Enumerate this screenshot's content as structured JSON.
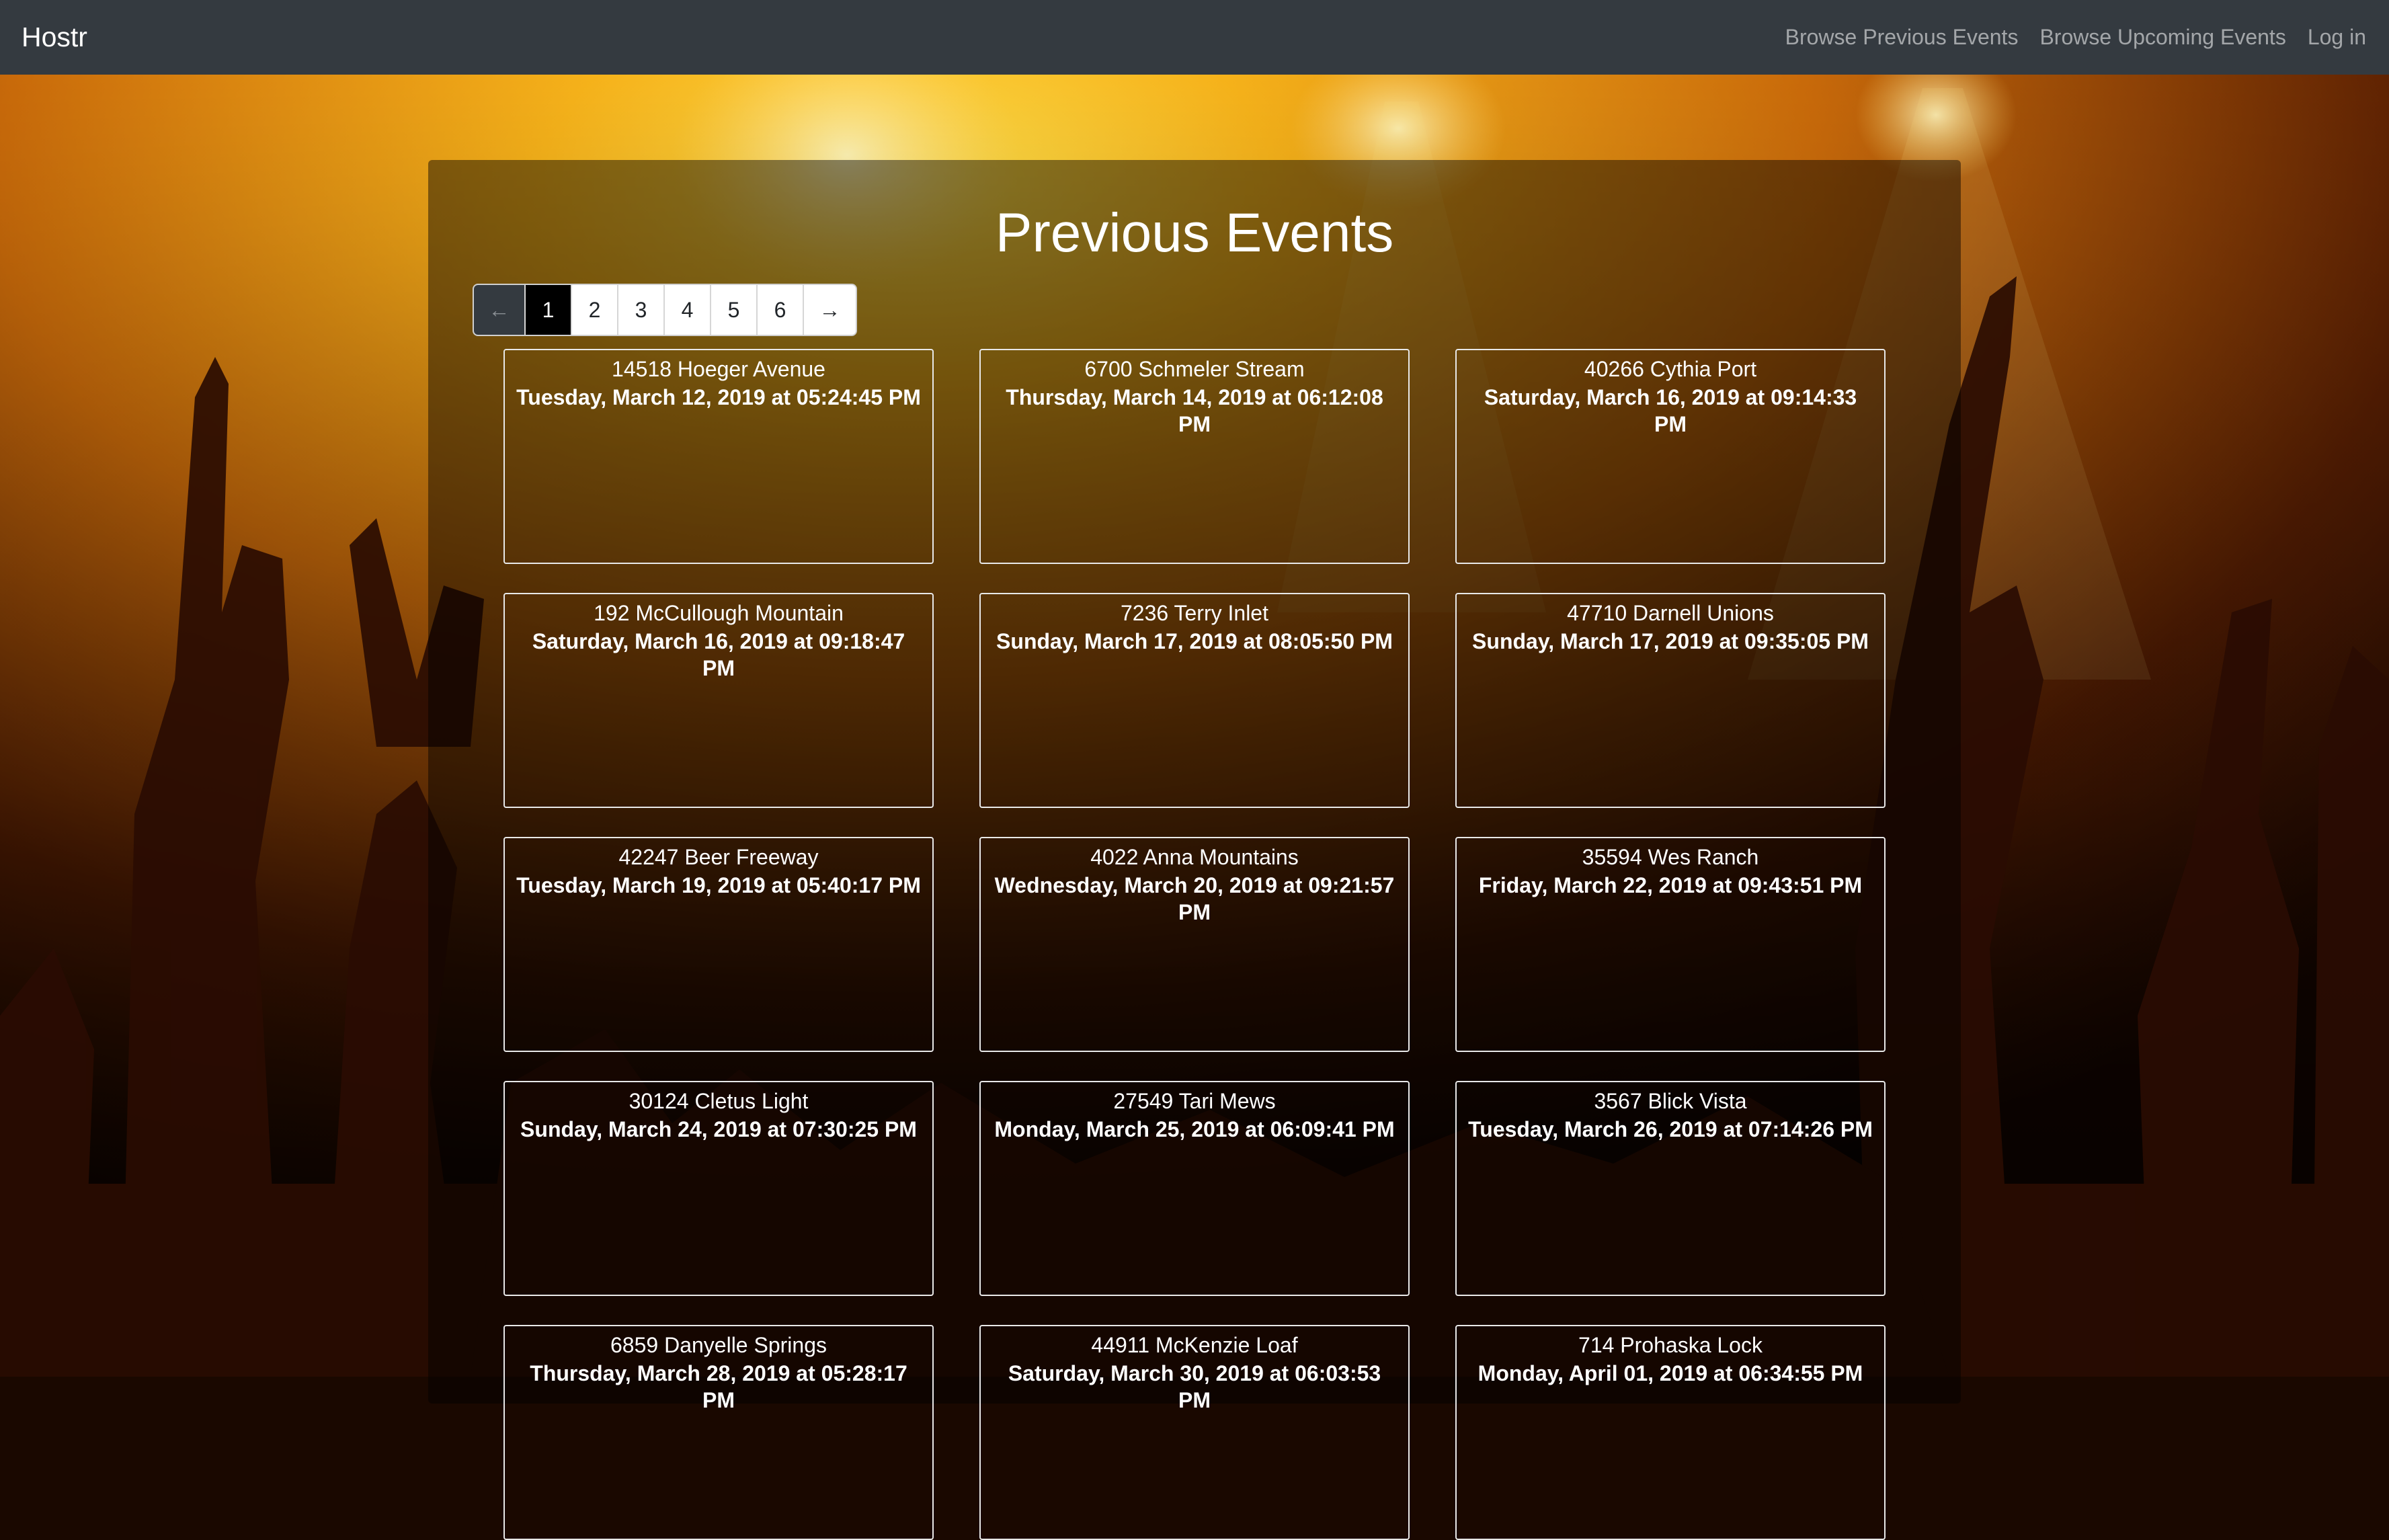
{
  "navbar": {
    "brand": "Hostr",
    "links": [
      "Browse Previous Events",
      "Browse Upcoming Events",
      "Log in"
    ]
  },
  "page": {
    "title": "Previous Events"
  },
  "pagination": {
    "prev": "←",
    "next": "→",
    "pages": [
      "1",
      "2",
      "3",
      "4",
      "5",
      "6"
    ],
    "active_page": "1"
  },
  "events": [
    {
      "address": "14518 Hoeger Avenue",
      "date": "Tuesday, March 12, 2019 at 05:24:45 PM"
    },
    {
      "address": "6700 Schmeler Stream",
      "date": "Thursday, March 14, 2019 at 06:12:08 PM"
    },
    {
      "address": "40266 Cythia Port",
      "date": "Saturday, March 16, 2019 at 09:14:33 PM"
    },
    {
      "address": "192 McCullough Mountain",
      "date": "Saturday, March 16, 2019 at 09:18:47 PM"
    },
    {
      "address": "7236 Terry Inlet",
      "date": "Sunday, March 17, 2019 at 08:05:50 PM"
    },
    {
      "address": "47710 Darnell Unions",
      "date": "Sunday, March 17, 2019 at 09:35:05 PM"
    },
    {
      "address": "42247 Beer Freeway",
      "date": "Tuesday, March 19, 2019 at 05:40:17 PM"
    },
    {
      "address": "4022 Anna Mountains",
      "date": "Wednesday, March 20, 2019 at 09:21:57 PM"
    },
    {
      "address": "35594 Wes Ranch",
      "date": "Friday, March 22, 2019 at 09:43:51 PM"
    },
    {
      "address": "30124 Cletus Light",
      "date": "Sunday, March 24, 2019 at 07:30:25 PM"
    },
    {
      "address": "27549 Tari Mews",
      "date": "Monday, March 25, 2019 at 06:09:41 PM"
    },
    {
      "address": "3567 Blick Vista",
      "date": "Tuesday, March 26, 2019 at 07:14:26 PM"
    },
    {
      "address": "6859 Danyelle Springs",
      "date": "Thursday, March 28, 2019 at 05:28:17 PM"
    },
    {
      "address": "44911 McKenzie Loaf",
      "date": "Saturday, March 30, 2019 at 06:03:53 PM"
    },
    {
      "address": "714 Prohaska Lock",
      "date": "Monday, April 01, 2019 at 06:34:55 PM"
    }
  ]
}
